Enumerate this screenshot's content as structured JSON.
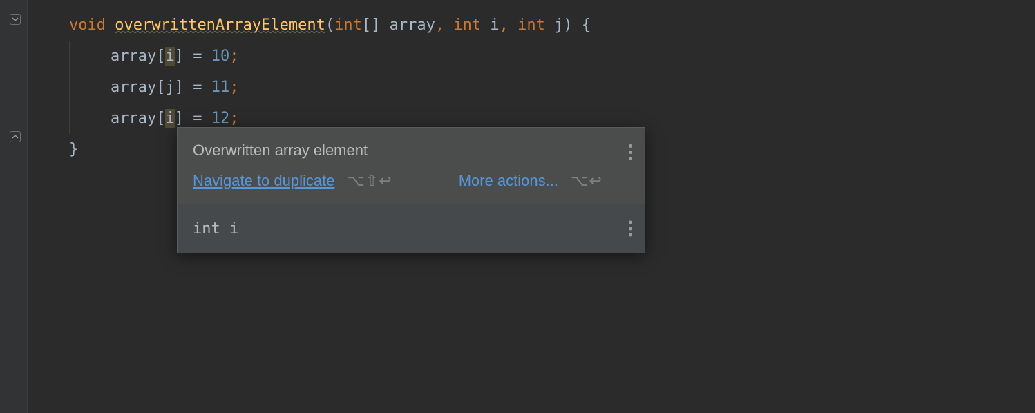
{
  "code": {
    "line1": {
      "kw_void": "void",
      "method": "overwrittenArrayElement",
      "paren_open": "(",
      "type_int_arr": "int",
      "brackets": "[]",
      "param_array": "array",
      "comma1": ",",
      "type_int2": "int",
      "param_i": "i",
      "comma2": ",",
      "type_int3": "int",
      "param_j": "j",
      "paren_close": ")",
      "brace_open": "{"
    },
    "line2": {
      "array": "array",
      "bopen": "[",
      "idx": "i",
      "bclose": "]",
      "assign": " = ",
      "val": "10",
      "semi": ";"
    },
    "line3": {
      "array": "array",
      "bopen": "[",
      "idx": "j",
      "bclose": "]",
      "assign": " = ",
      "val": "11",
      "semi": ";"
    },
    "line4": {
      "array": "array",
      "bopen": "[",
      "idx": "i",
      "bclose": "]",
      "assign": " = ",
      "val": "12",
      "semi": ";"
    },
    "line5": {
      "brace_close": "}"
    }
  },
  "popup": {
    "title": "Overwritten array element",
    "navigate_label": "Navigate to duplicate",
    "navigate_shortcut": "⌥⇧↩",
    "more_label": "More actions...",
    "more_shortcut": "⌥↩",
    "type_info": "int i"
  }
}
